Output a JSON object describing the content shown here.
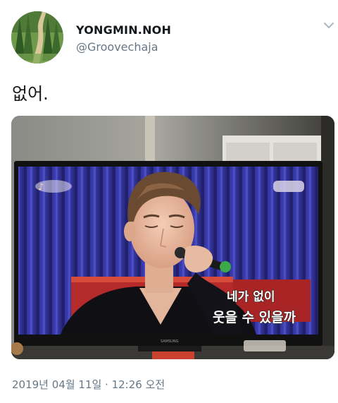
{
  "tweet": {
    "author": {
      "display_name": "YONGMIN.NOH",
      "handle": "@Groovechaja",
      "avatar_icon": "forest-avatar"
    },
    "menu_icon": "chevron-down-icon",
    "text": "없어.",
    "media": {
      "tv_brand": "SAMSUNG",
      "caption_line_1": "네가 없이",
      "caption_line_2": "웃을 수 있을까"
    },
    "timestamp": "2019년 04월 11일 · 12:26 오전"
  },
  "colors": {
    "text_primary": "#14171a",
    "text_secondary": "#657786",
    "chevron": "#aab8c2"
  }
}
